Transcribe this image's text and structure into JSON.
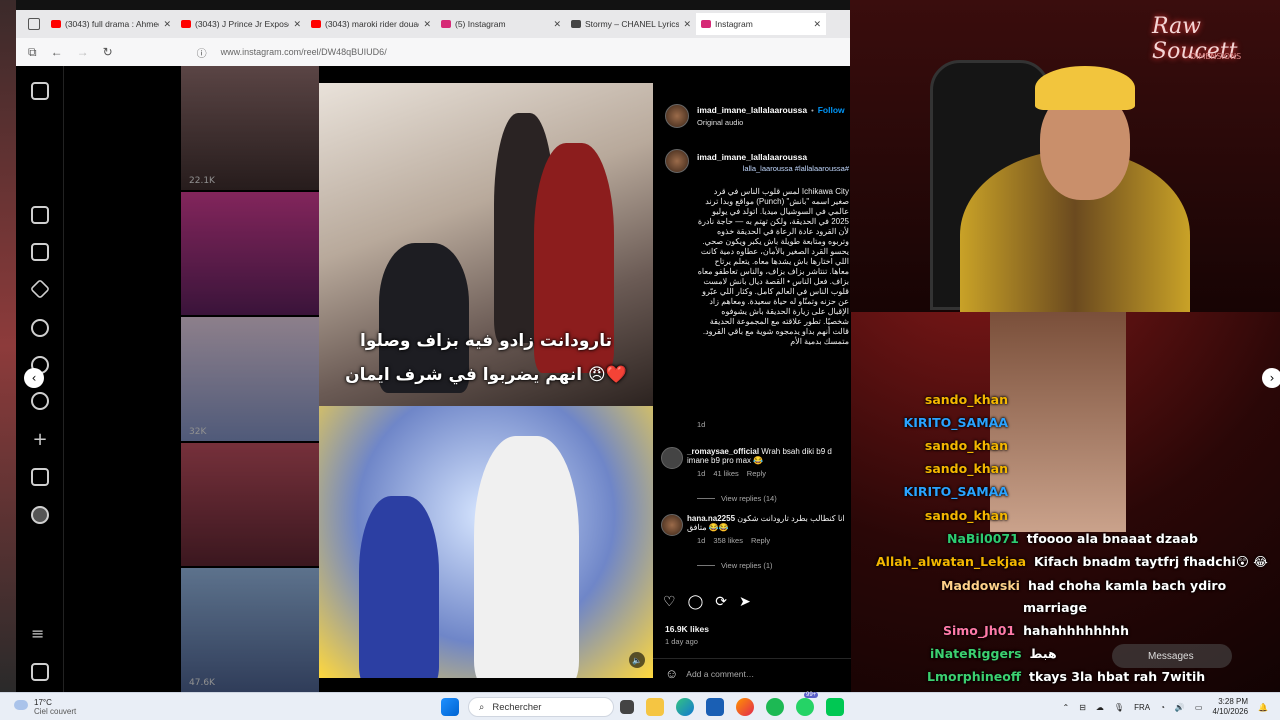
{
  "browser": {
    "tabs": [
      {
        "title": "(3043) full drama : Ahmed",
        "icon_color": "#ff0000"
      },
      {
        "title": "(3043) J Prince Jr Exposed",
        "icon_color": "#ff0000"
      },
      {
        "title": "(3043) maroki rider douae",
        "icon_color": "#ff0000"
      },
      {
        "title": "(5) Instagram",
        "icon_color": "#d62976"
      },
      {
        "title": "Stormy – CHANEL Lyrics |",
        "icon_color": "#444444"
      },
      {
        "title": "Instagram",
        "icon_color": "#d62976"
      }
    ],
    "url": "www.instagram.com/reel/DW48qBUIUD6/"
  },
  "instagram": {
    "grid_views": [
      "22.1K",
      "",
      "32K",
      "",
      "47.6K"
    ],
    "reel": {
      "caption_line1": "تارودانت زادو فيه بزاف وصلوا",
      "caption_line2": "انهم يضربوا في شرف ايمان 😠❤️"
    },
    "post": {
      "author": "imad_imane_lallalaaroussa",
      "follow_label": "Follow",
      "audio": "Original audio",
      "caption_author": "imad_imane_lallalaaroussa",
      "hashtags": "#lalla_laaroussa #lallalaaroussa",
      "body": "Ichikawa City لمس قلوب الناس في قرد صغير اسمه \"بانش\" (Punch) مواقع وبدا ترند عالمي في السوشيال ميديا. اتولد في يوليو 2025 في الحديقة، ولكن تهتم به — حاجة نادرة لأن القرود عادة الرعاة في الحديقة خذوه وتربوه ومتابعة طويلة باش يكبر ويكون صحي. يحسو القرد الصغير بالأمان، عطاوه دمية كانت اللي اختارها باش يشدها معاه. يتعلم يرتاح معاها. تنتاشر بزاف بزاف، والناس تعاطفو معاه بزاف. فعل الناس • القصة ديال بانش لامست قلوب الناس في العالم كامل. وكثار اللي عبّرو عن حزنه وتمنّاو له حياة سعيدة. ومعاهم زاد الإقبال على زيارة الحديقة باش يشوفوه شخصيًا. تطور علاقته مع المجموعة الحديقة قالت أنهم بداو يدمجوه شوية مع باقي القرود. متمسك بدمية الأم",
      "time": "1d",
      "comments": [
        {
          "user": "_romaysae_official",
          "text": "Wrah bsah diki b9 d imane b9 pro max 😂",
          "time": "1d",
          "likes": "41 likes",
          "reply": "Reply",
          "view_replies": "View replies (14)"
        },
        {
          "user": "hana.na2255",
          "text": "انا كنطالب بطرد تارودانت شكون متافق 😂😂",
          "time": "1d",
          "likes": "358 likes",
          "reply": "Reply",
          "view_replies": "View replies (1)"
        }
      ],
      "likes": "16.9K likes",
      "ago": "1 day ago",
      "add_comment": "Add a comment…"
    }
  },
  "stream": {
    "logo": "Raw Soucett",
    "logo_sub": "DIMENSIONS",
    "chat": [
      {
        "user": "sando_khan",
        "msg": "",
        "color": "#f5b700"
      },
      {
        "user": "KIRITO_SAMAA",
        "msg": "",
        "color": "#2aa3ff"
      },
      {
        "user": "sando_khan",
        "msg": "",
        "color": "#f5b700"
      },
      {
        "user": "sando_khan",
        "msg": "",
        "color": "#f5b700"
      },
      {
        "user": "KIRITO_SAMAA",
        "msg": "",
        "color": "#2aa3ff"
      },
      {
        "user": "sando_khan",
        "msg": "",
        "color": "#f5b700"
      },
      {
        "user": "NaBil0071",
        "msg": "tfoooo ala bnaaat dzaab",
        "color": "#2ecc71"
      },
      {
        "user": "Allah_alwatan_Lekjaa",
        "msg": "Kifach bnadm taytfrj fhadchi😲 😂",
        "color": "#f5b700"
      },
      {
        "user": "Maddowski",
        "msg": "had choha kamla bach ydiro",
        "msg2": "marriage",
        "color": "#ffd18a"
      },
      {
        "user": "Simo_Jh01",
        "msg": "hahahhhhhhhh",
        "color": "#ff7aa8"
      },
      {
        "user": "iNateRiggers",
        "msg": "هبط",
        "color": "#3cd070"
      },
      {
        "user": "Lmorphineoff",
        "msg": "tkays 3la hbat rah 7witih",
        "color": "#3cd070"
      }
    ],
    "messages_label": "Messages"
  },
  "taskbar": {
    "temp": "17°C",
    "weather": "Ciel couvert",
    "search_label": "Rechercher",
    "lang": "FRA",
    "time": "3:28 PM",
    "date": "4/10/2026",
    "badge": "99+"
  }
}
